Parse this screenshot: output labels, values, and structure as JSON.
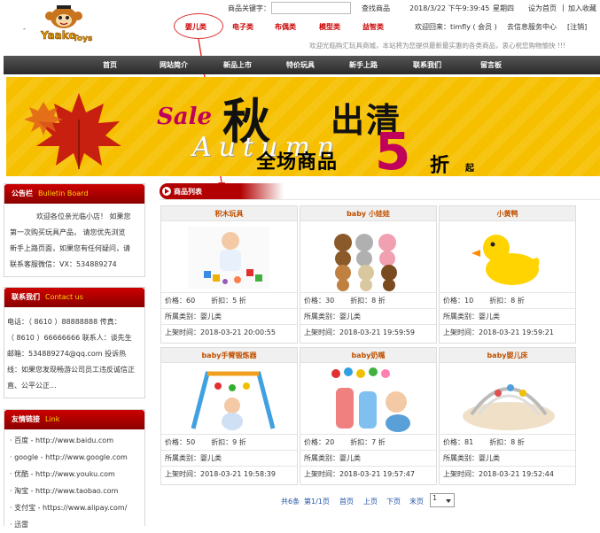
{
  "header": {
    "search_label": "商品关键字：",
    "search_value": "",
    "search_button": "查找商品",
    "datetime": "2018/3/22 下午9:39:45",
    "weekday": "星期四",
    "set_home": "设为首页",
    "separator": "|",
    "add_favorite": "加入收藏",
    "welcome": "欢迎回来：timfly ( 会员 )",
    "info_center": "去信息服务中心",
    "logout": "[注销]",
    "slogan": "欢迎光临购汇玩具商城，本站将为您提供最新最实惠的各类商品，衷心祝您购物愉快 !!!",
    "dash": "-",
    "categories": [
      "婴儿类",
      "电子类",
      "布偶类",
      "模型类",
      "益智类"
    ]
  },
  "nav": [
    "首页",
    "网站简介",
    "新品上市",
    "特价玩具",
    "新手上路",
    "联系我们",
    "留言板"
  ],
  "banner": {
    "sale": "Sale",
    "qiu": "秋",
    "chuqing": "出清",
    "autumn": "Autumn",
    "whole": "全场商品",
    "five": "5",
    "zhe": "折",
    "qi": "起"
  },
  "bulletin": {
    "title": "公告栏",
    "subtitle": "Bulletin Board",
    "lines": [
      "欢迎各位亲光临小店！ 如果您",
      "第一次购买玩具产品， 请您优先浏览",
      "新手上路页面，如果您有任何疑问，请",
      "联系客服微信：VX：534889274"
    ]
  },
  "contact": {
    "title": "联系我们",
    "subtitle": "Contact us",
    "lines": [
      "电话：（ 8610 ）88888888 传真：",
      "（ 8610 ）66666666 联系人：谈先生",
      "邮箱：534889274@qq.com 投诉热",
      "线：如果您发现畅游公司员工违反诚信正",
      "直、公平公正..."
    ]
  },
  "links": {
    "title": "友情链接",
    "subtitle": "Link",
    "items": [
      "· 百度 - http://www.baidu.com",
      "· google - http://www.google.com",
      "· 优酷 - http://www.youku.com",
      "· 淘宝 - http://www.taobao.com",
      "· 支付宝 - https://www.alipay.com/",
      "· 迅雷"
    ]
  },
  "products": {
    "title": "商品列表",
    "items": [
      {
        "name": "积木玩具",
        "price": "价格：60",
        "discount": "折扣：5 折",
        "category": "所属类别：婴儿类",
        "time": "上架时间：2018-03-21 20:00:55"
      },
      {
        "name": "baby 小娃娃",
        "price": "价格：30",
        "discount": "折扣：8 折",
        "category": "所属类别：婴儿类",
        "time": "上架时间：2018-03-21 19:59:59"
      },
      {
        "name": "小黄鸭",
        "price": "价格：10",
        "discount": "折扣：8 折",
        "category": "所属类别：婴儿类",
        "time": "上架时间：2018-03-21 19:59:21"
      },
      {
        "name": "baby手臂锻炼器",
        "price": "价格：50",
        "discount": "折扣：9 折",
        "category": "所属类别：婴儿类",
        "time": "上架时间：2018-03-21 19:58:39"
      },
      {
        "name": "baby奶嘴",
        "price": "价格：20",
        "discount": "折扣：7 折",
        "category": "所属类别：婴儿类",
        "time": "上架时间：2018-03-21 19:57:47"
      },
      {
        "name": "baby婴儿床",
        "price": "价格：81",
        "discount": "折扣：8 折",
        "category": "所属类别：婴儿类",
        "time": "上架时间：2018-03-21 19:52:44"
      }
    ]
  },
  "pager": {
    "total": "共6条",
    "page_of": "第1/1页",
    "first": "首页",
    "prev": "上页",
    "next": "下页",
    "last": "末页",
    "current": "1"
  },
  "colors": {
    "nav_bg": "#333333",
    "accent_red": "#b30000",
    "banner_yellow": "#f6c000",
    "product_name": "#c05000"
  }
}
